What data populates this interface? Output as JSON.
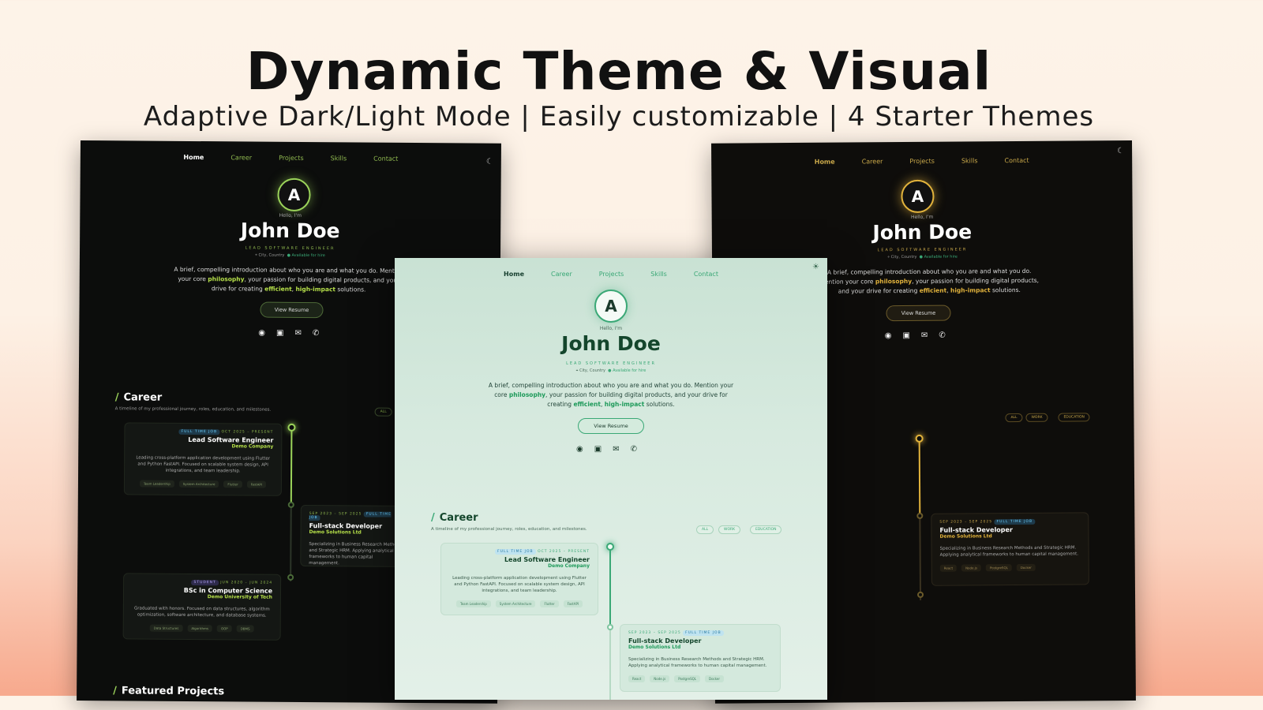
{
  "header": {
    "title": "Dynamic Theme & Visual",
    "subtitle": "Adaptive Dark/Light Mode | Easily customizable | 4 Starter Themes"
  },
  "nav": [
    "Home",
    "Career",
    "Projects",
    "Skills",
    "Contact"
  ],
  "profile": {
    "greeting": "Hello, I'm",
    "name": "John Doe",
    "role": "LEAD SOFTWARE ENGINEER",
    "location": "City, Country",
    "availability": "Available for hire",
    "logo_letter": "A",
    "intro_1": "A brief, compelling introduction about who you are and what you do. Mention your core ",
    "intro_hl1": "philosophy",
    "intro_2": ", your passion for building digital products, and your drive for creating ",
    "intro_hl2": "efficient",
    "intro_3": ", ",
    "intro_hl3": "high-impact",
    "intro_4": " solutions.",
    "resume_button": "View Resume"
  },
  "socials": [
    "github-icon",
    "linkedin-icon",
    "mail-icon",
    "whatsapp-icon"
  ],
  "career": {
    "heading": "Career",
    "subtitle": "A timeline of my professional journey, roles, education, and milestones.",
    "filters": [
      "ALL",
      "WORK",
      "EDUCATION"
    ],
    "jobs": [
      {
        "badge": "FULL TIME JOB",
        "dates": "OCT 2025 – PRESENT",
        "title": "Lead Software Engineer",
        "company": "Demo Company",
        "desc": "Leading cross-platform application development using Flutter and Python FastAPI. Focused on scalable system design, API integrations, and team leadership.",
        "tags": [
          "Team Leadership",
          "System Architecture",
          "Flutter",
          "FastAPI"
        ]
      },
      {
        "badge": "FULL TIME JOB",
        "dates": "SEP 2023 – SEP 2025",
        "title": "Full-stack Developer",
        "company": "Demo Solutions Ltd",
        "desc": "Specializing in Business Research Methods and Strategic HRM. Applying analytical frameworks to human capital management.",
        "tags": [
          "React",
          "Node.js",
          "PostgreSQL",
          "Docker"
        ]
      },
      {
        "badge": "STUDENT",
        "dates": "JUN 2020 – JUN 2024",
        "title": "BSc in Computer Science",
        "company": "Demo University of Tech",
        "desc": "Graduated with honors. Focused on data structures, algorithm optimization, software architecture, and database systems.",
        "tags": [
          "Data Structures",
          "Algorithms",
          "OOP",
          "DBMS"
        ]
      }
    ]
  },
  "projects_heading": "Featured Projects",
  "theme_toggle": {
    "dark": "moon-icon",
    "light": "sun-icon"
  },
  "colors": {
    "dark_accent": "#9bd35a",
    "gold_accent": "#e2b33c",
    "light_accent": "#3aa876"
  }
}
